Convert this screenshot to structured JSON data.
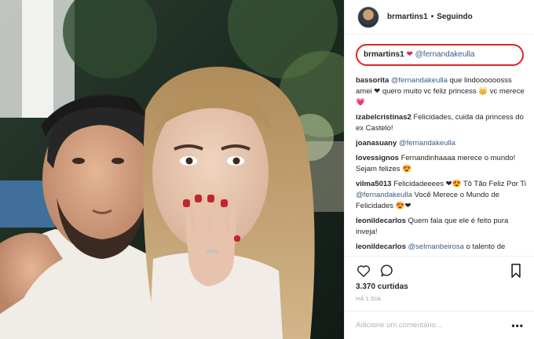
{
  "header": {
    "username": "brmartins1",
    "separator": "•",
    "follow_status": "Seguindo"
  },
  "caption": {
    "username": "brmartins1",
    "heart": "❤",
    "mention": "@fernandakeulla"
  },
  "comments": [
    {
      "user": "bassorita",
      "parts": [
        {
          "text": "@fernandakeulla",
          "mention": true
        },
        {
          "text": " que lindoooooosss amei ❤ quero muito vc feliz princess 👑 vc merece 💗"
        }
      ]
    },
    {
      "user": "izabelcristinas2",
      "parts": [
        {
          "text": "Felicidades, cuida da princess do ex Castelo!"
        }
      ]
    },
    {
      "user": "joanasuany",
      "parts": [
        {
          "text": "@fernandakeulla",
          "mention": true
        }
      ]
    },
    {
      "user": "lovessignos",
      "parts": [
        {
          "text": "Fernandinhaaaa merece o mundo! Sejam felizes 😍"
        }
      ]
    },
    {
      "user": "vilma5013",
      "parts": [
        {
          "text": "Felicidadeeees ❤😍 Tô Tão Feliz Por Ti "
        },
        {
          "text": "@fernandakeulla",
          "mention": true
        },
        {
          "text": " Você Merece o Mundo de Felicidades 😍❤"
        }
      ]
    },
    {
      "user": "leonildecarlos",
      "parts": [
        {
          "text": "Quem fala que ele é feito pura inveja!"
        }
      ]
    },
    {
      "user": "leonildecarlos",
      "parts": [
        {
          "text": "@selmanbeirosa",
          "mention": true
        },
        {
          "text": " o talento de querida nada mais justo..."
        }
      ]
    }
  ],
  "actions": {
    "like_icon": "heart-outline-icon",
    "comment_icon": "speech-bubble-icon",
    "save_icon": "bookmark-icon"
  },
  "likes": "3.370 curtidas",
  "time_ago": "HÁ 1 DIA",
  "add_comment": {
    "placeholder": "Adicione um comentário...",
    "more": "•••"
  },
  "colors": {
    "highlight_border": "#d8262b",
    "mention": "#3b5b86",
    "heart": "#e0245e"
  }
}
